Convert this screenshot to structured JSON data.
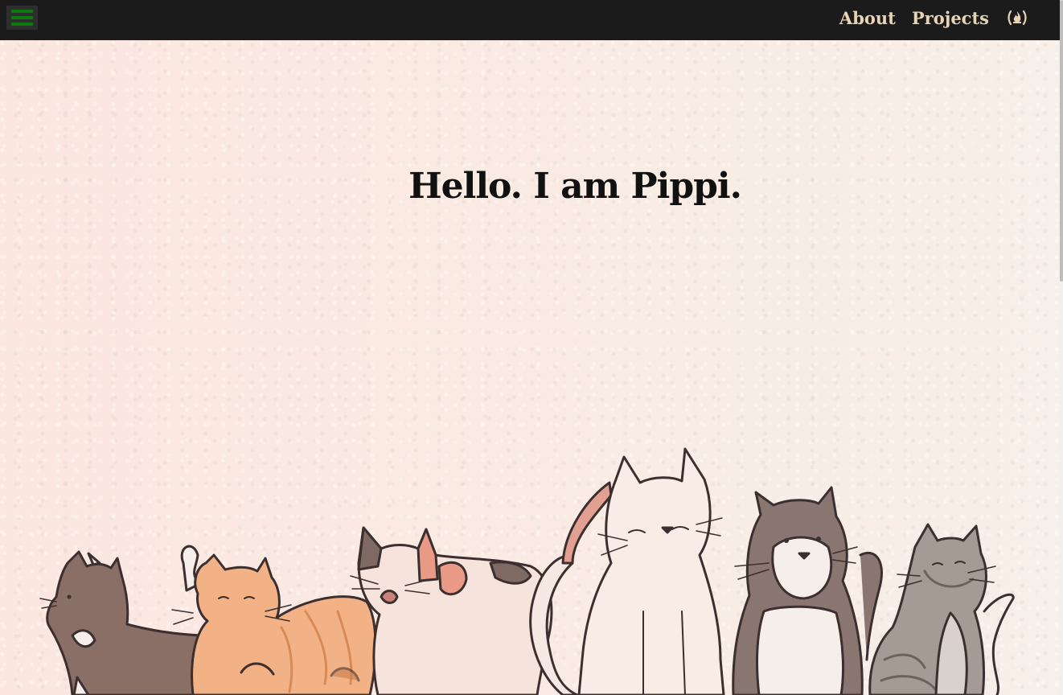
{
  "nav": {
    "menu_icon": "hamburger-icon",
    "links": [
      {
        "label": "About"
      },
      {
        "label": "Projects"
      }
    ],
    "fcc_icon": "freecodecamp-icon"
  },
  "hero": {
    "title": "Hello. I am Pippi."
  },
  "illustration": {
    "subject": "cats-illustration",
    "cats": [
      "brown-white-cat",
      "orange-tabby-cat",
      "calico-cat",
      "white-cat",
      "brown-white-cat",
      "gray-tabby-cat"
    ]
  },
  "colors": {
    "navbar": "#1b1b1b",
    "nav_link": "#e9d3b3",
    "menu_bars": "#0c7a0c",
    "background": "#f9ebe3"
  }
}
